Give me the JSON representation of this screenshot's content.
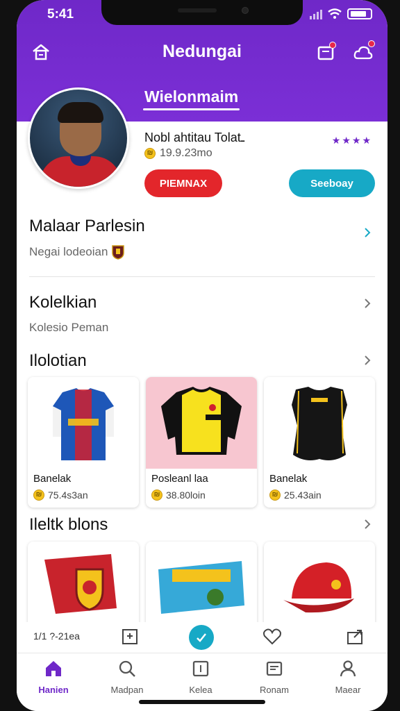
{
  "status": {
    "time": "5:41"
  },
  "header": {
    "title": "Nedungai",
    "subtitle": "Wielonmaim"
  },
  "profile": {
    "name": "Nobl ahtitau Tolatـ",
    "meta": "19.9.23mo",
    "rating": "★★★★",
    "btn_primary": "PIEMNAX",
    "btn_secondary": "Seeboay"
  },
  "sections": {
    "s1_title": "Malaar Parlesin",
    "s1_sub": "Negai lodeoian",
    "s2_title": "Kolelkian",
    "s2_sub": "Kolesio Peman",
    "s3_title": "Ilolotian",
    "s4_title": "Ileltk blons"
  },
  "products": [
    {
      "name": "Banelak",
      "price": "75.4s3an"
    },
    {
      "name": "Posleanl laa",
      "price": "38.80loin"
    },
    {
      "name": "Banelak",
      "price": "25.43ain"
    }
  ],
  "mini_row": {
    "left_label": "1/1 ?-21ea"
  },
  "nav": [
    {
      "label": "Hanien",
      "icon": "home-icon"
    },
    {
      "label": "Madpan",
      "icon": "search-icon"
    },
    {
      "label": "Kelea",
      "icon": "box-icon"
    },
    {
      "label": "Ronam",
      "icon": "cart-icon"
    },
    {
      "label": "Maear",
      "icon": "user-icon"
    }
  ],
  "colors": {
    "brand": "#6f28c8",
    "accent_red": "#e3262b",
    "accent_teal": "#17a9c6"
  }
}
